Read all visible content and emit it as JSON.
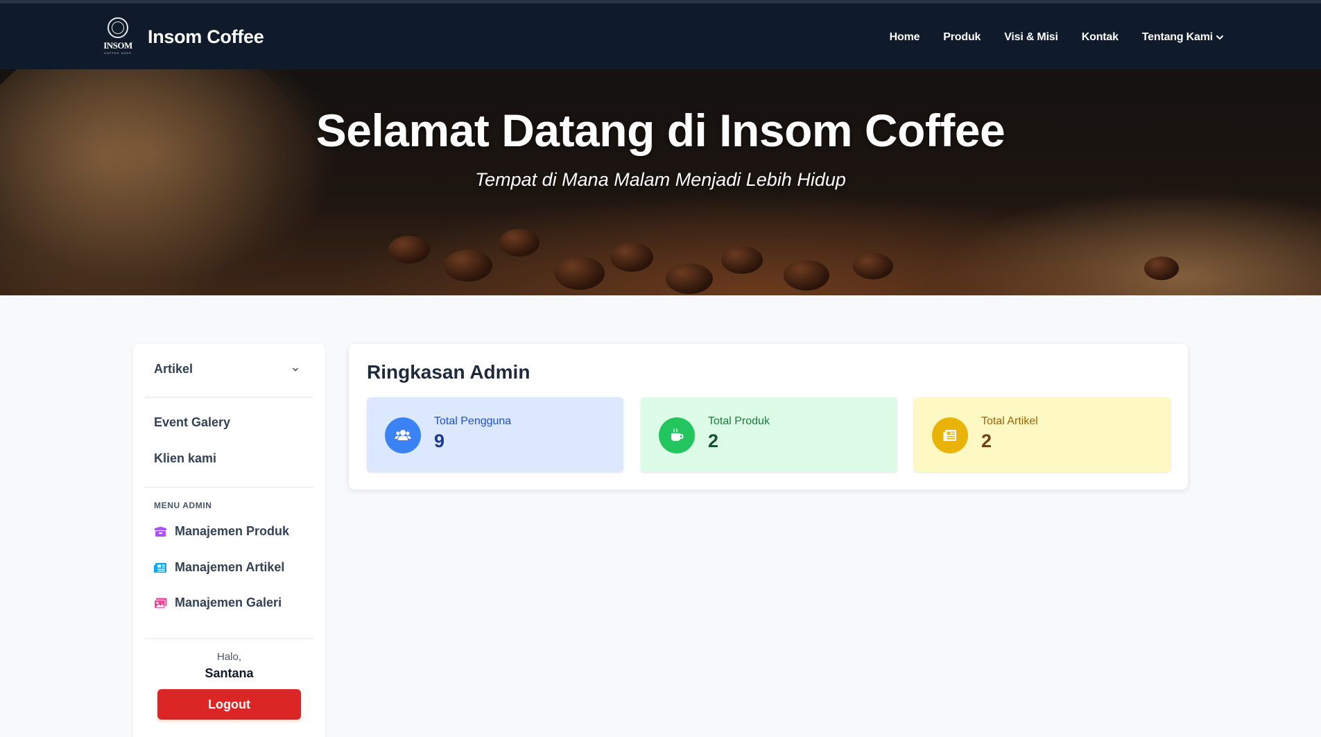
{
  "navbar": {
    "logo_text": "INSOM",
    "logo_subtext": "COFFEE SHOP",
    "brand": "Insom Coffee",
    "links": [
      "Home",
      "Produk",
      "Visi & Misi",
      "Kontak"
    ],
    "dropdown_label": "Tentang Kami"
  },
  "hero": {
    "title": "Selamat Datang di Insom Coffee",
    "subtitle": "Tempat di Mana Malam Menjadi Lebih Hidup"
  },
  "sidebar": {
    "dropdown_label": "Artikel",
    "links": [
      "Event Galery",
      "Klien kami"
    ],
    "admin_section": "MENU ADMIN",
    "admin_items": [
      {
        "label": "Manajemen Produk",
        "icon": "box-icon",
        "color": "#a855f7"
      },
      {
        "label": "Manajemen Artikel",
        "icon": "newspaper-icon",
        "color": "#0ea5e9"
      },
      {
        "label": "Manajemen Galeri",
        "icon": "image-icon",
        "color": "#ec4899"
      }
    ],
    "greeting": "Halo,",
    "username": "Santana",
    "logout_label": "Logout"
  },
  "summary": {
    "title": "Ringkasan Admin",
    "stats": [
      {
        "label": "Total Pengguna",
        "value": "9",
        "icon": "users-icon",
        "color": "#3b82f6"
      },
      {
        "label": "Total Produk",
        "value": "2",
        "icon": "coffee-cup-icon",
        "color": "#22c55e"
      },
      {
        "label": "Total Artikel",
        "value": "2",
        "icon": "newspaper-icon",
        "color": "#eab308"
      }
    ]
  },
  "colors": {
    "navbar_bg": "#0f1a2b",
    "logout_bg": "#dc2626",
    "page_bg": "#f8f9fb"
  }
}
